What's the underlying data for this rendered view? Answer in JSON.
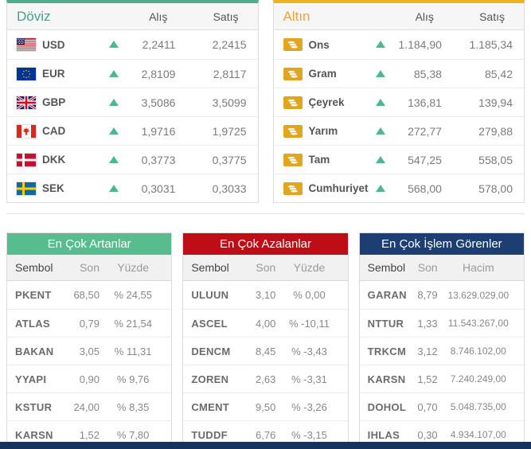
{
  "trend_up_color": "#4db694",
  "doviz": {
    "title": "Döviz",
    "title_color": "#3fa28c",
    "accent": "#4fae8e",
    "col_alis": "Alış",
    "col_satis": "Satış",
    "trend_icon": "triangle-up",
    "rows": [
      {
        "code": "USD",
        "flag": "us",
        "trend": "up",
        "alis": "2,2411",
        "satis": "2,2415"
      },
      {
        "code": "EUR",
        "flag": "eu",
        "trend": "up",
        "alis": "2,8109",
        "satis": "2,8117"
      },
      {
        "code": "GBP",
        "flag": "gb",
        "trend": "up",
        "alis": "3,5086",
        "satis": "3,5099"
      },
      {
        "code": "CAD",
        "flag": "ca",
        "trend": "up",
        "alis": "1,9716",
        "satis": "1,9725"
      },
      {
        "code": "DKK",
        "flag": "dk",
        "trend": "up",
        "alis": "0,3773",
        "satis": "0,3775"
      },
      {
        "code": "SEK",
        "flag": "se",
        "trend": "up",
        "alis": "0,3031",
        "satis": "0,3033"
      }
    ]
  },
  "altin": {
    "title": "Altın",
    "title_color": "#e8a43c",
    "accent": "#ecb31f",
    "col_alis": "Alış",
    "col_satis": "Satış",
    "row_icon": "gold-coins",
    "trend_icon": "triangle-up",
    "rows": [
      {
        "name": "Ons",
        "trend": "up",
        "alis": "1.184,90",
        "satis": "1.185,34"
      },
      {
        "name": "Gram",
        "trend": "up",
        "alis": "85,38",
        "satis": "85,42"
      },
      {
        "name": "Çeyrek",
        "trend": "up",
        "alis": "136,81",
        "satis": "139,94"
      },
      {
        "name": "Yarım",
        "trend": "up",
        "alis": "272,77",
        "satis": "279,88"
      },
      {
        "name": "Tam",
        "trend": "up",
        "alis": "547,25",
        "satis": "558,05"
      },
      {
        "name": "Cumhuriyet",
        "trend": "up",
        "alis": "568,00",
        "satis": "578,00"
      }
    ]
  },
  "stocks": {
    "gainers": {
      "title": "En Çok Artanlar",
      "accent": "#57bd8f",
      "columns": [
        "Sembol",
        "Son",
        "Yüzde"
      ],
      "rows": [
        [
          "PKENT",
          "68,50",
          "% 24,55"
        ],
        [
          "ATLAS",
          "0,79",
          "% 21,54"
        ],
        [
          "BAKAN",
          "3,05",
          "% 11,31"
        ],
        [
          "YYAPI",
          "0,90",
          "% 9,76"
        ],
        [
          "KSTUR",
          "24,00",
          "% 8,35"
        ],
        [
          "KARSN",
          "1,52",
          "% 7,80"
        ]
      ]
    },
    "losers": {
      "title": "En Çok Azalanlar",
      "accent": "#bf0d17",
      "columns": [
        "Sembol",
        "Son",
        "Yüzde"
      ],
      "rows": [
        [
          "ULUUN",
          "3,10",
          "% 0,00"
        ],
        [
          "ASCEL",
          "4,00",
          "% -10,11"
        ],
        [
          "DENCM",
          "8,45",
          "% -3,43"
        ],
        [
          "ZOREN",
          "2,63",
          "% -3,31"
        ],
        [
          "CMENT",
          "9,50",
          "% -3,26"
        ],
        [
          "TUDDF",
          "6,76",
          "% -3,15"
        ]
      ]
    },
    "most_traded": {
      "title": "En Çok İşlem Görenler",
      "accent": "#1d3e73",
      "columns": [
        "Sembol",
        "Son",
        "Hacim"
      ],
      "rows": [
        [
          "GARAN",
          "8,79",
          "13.629.029,00"
        ],
        [
          "NTTUR",
          "1,33",
          "11.543.267,00"
        ],
        [
          "TRKCM",
          "3,12",
          "8.746.102,00"
        ],
        [
          "KARSN",
          "1,52",
          "7.240.249,00"
        ],
        [
          "DOHOL",
          "0,70",
          "5.048.735,00"
        ],
        [
          "IHLAS",
          "0,30",
          "4.934.107,00"
        ]
      ]
    }
  },
  "footer": {
    "color": "#17325f"
  }
}
